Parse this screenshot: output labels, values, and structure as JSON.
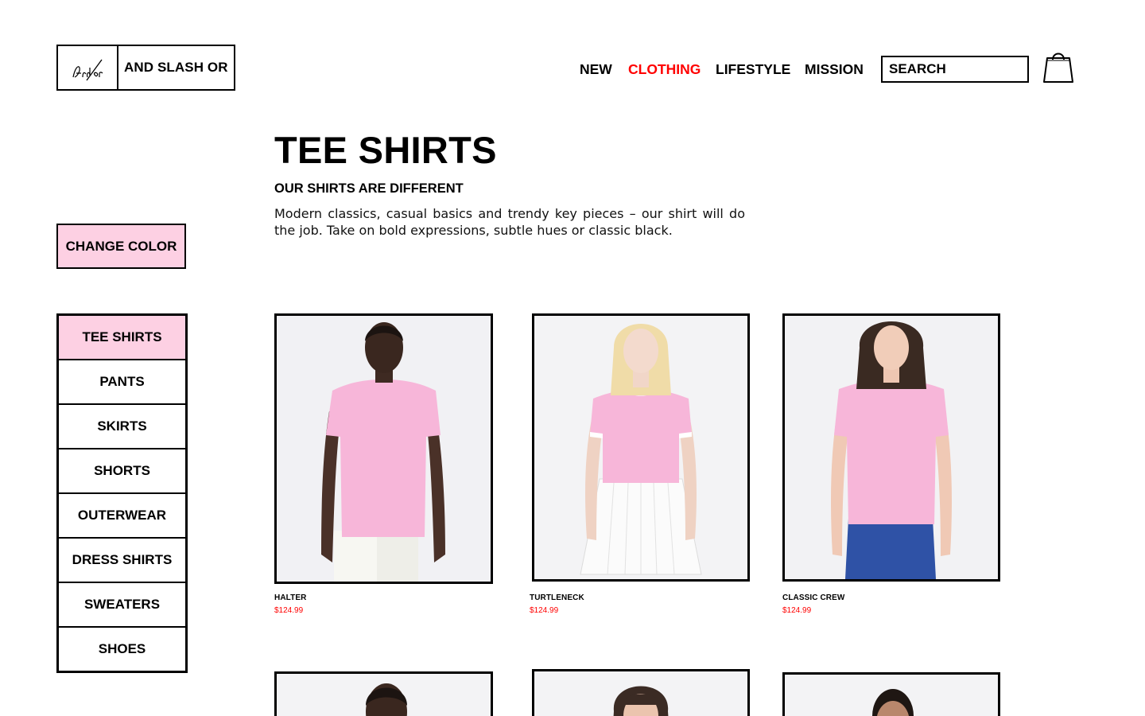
{
  "brand": {
    "logo_mark": "And/or",
    "name": "AND SLASH OR"
  },
  "nav": {
    "items": [
      {
        "label": "NEW",
        "active": false
      },
      {
        "label": "CLOTHING",
        "active": true
      },
      {
        "label": "LIFESTYLE",
        "active": false
      },
      {
        "label": "MISSION",
        "active": false
      }
    ],
    "active_color": "#ff0000"
  },
  "search": {
    "placeholder": "SEARCH"
  },
  "cart": {
    "icon": "shopping-bag-icon"
  },
  "hero": {
    "title": "TEE SHIRTS",
    "subtitle": "OUR SHIRTS ARE DIFFERENT",
    "description": "Modern classics, casual basics and trendy key pieces – our shirt will do the job. Take on bold expressions, subtle hues or classic black."
  },
  "sidebar": {
    "change_color_label": "CHANGE COLOR",
    "accent_color": "#fdd0e3",
    "categories": [
      {
        "label": "TEE SHIRTS",
        "active": true
      },
      {
        "label": "PANTS",
        "active": false
      },
      {
        "label": "SKIRTS",
        "active": false
      },
      {
        "label": "SHORTS",
        "active": false
      },
      {
        "label": "OUTERWEAR",
        "active": false
      },
      {
        "label": "DRESS SHIRTS",
        "active": false
      },
      {
        "label": "SWEATERS",
        "active": false
      },
      {
        "label": "SHOES",
        "active": false
      }
    ]
  },
  "products": [
    {
      "name": "HALTER",
      "price": "$124.99",
      "shirt_color": "#f7b6d9",
      "bottom": "white-pants"
    },
    {
      "name": "TURTLENECK",
      "price": "$124.99",
      "shirt_color": "#f7b6d9",
      "bottom": "white-skirt"
    },
    {
      "name": "CLASSIC CREW",
      "price": "$124.99",
      "shirt_color": "#f7b6d9",
      "bottom": "blue-jeans"
    }
  ]
}
